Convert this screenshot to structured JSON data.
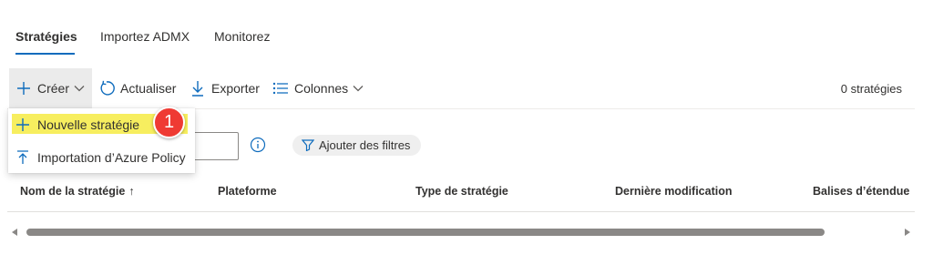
{
  "tabs": [
    {
      "label": "Stratégies",
      "active": true
    },
    {
      "label": "Importez ADMX",
      "active": false
    },
    {
      "label": "Monitorez",
      "active": false
    }
  ],
  "toolbar": {
    "create_label": "Créer",
    "refresh_label": "Actualiser",
    "export_label": "Exporter",
    "columns_label": "Colonnes",
    "count_text": "0 stratégies"
  },
  "create_menu": {
    "items": [
      {
        "label": "Nouvelle stratégie",
        "icon": "plus-icon"
      },
      {
        "label": "Importation d’Azure Policy",
        "icon": "import-icon"
      }
    ]
  },
  "annotation": {
    "badge_number": "1",
    "badge_color": "#ef3a33",
    "highlight_color": "#f7ee5f"
  },
  "filter": {
    "add_filters_label": "Ajouter des filtres"
  },
  "grid": {
    "columns": [
      "Nom de la stratégie",
      "Plateforme",
      "Type de stratégie",
      "Dernière modification",
      "Balises d’étendue"
    ],
    "sort_indicator": "↑"
  },
  "colors": {
    "accent": "#0f6cbd",
    "text": "#323130"
  }
}
